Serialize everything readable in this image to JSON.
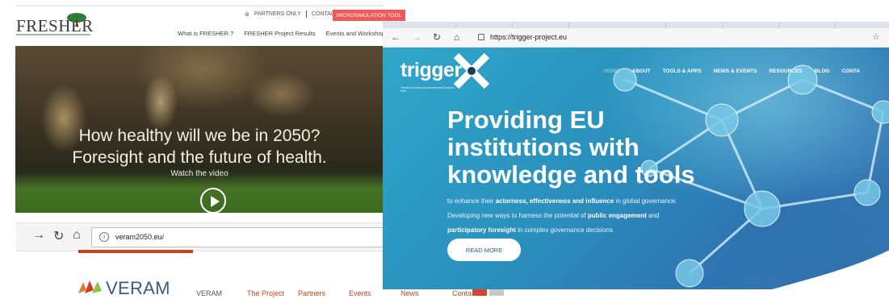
{
  "fresher": {
    "logo": "FRESHER",
    "utility": {
      "partners": "PARTNERS ONLY",
      "contact": "CONTACT"
    },
    "microsim_button": "MICROSIMULATION TOOL",
    "nav": [
      "What is FRESHER ?",
      "FRESHER Project Results",
      "Events and Workshops"
    ],
    "hero": {
      "line1": "How healthy will we be in 2050?",
      "line2": "Foresight and the future of health.",
      "watch": "Watch the video"
    }
  },
  "veram": {
    "url": "veram2050.eu/",
    "logo": "VERAM",
    "menu": [
      {
        "label": "VERAM",
        "color": "#555555"
      },
      {
        "label": "The Project",
        "color": "#c9441e"
      },
      {
        "label": "Partners",
        "color": "#c9441e"
      },
      {
        "label": "Events",
        "color": "#c9441e"
      },
      {
        "label": "News",
        "color": "#c9441e"
      },
      {
        "label": "Conta",
        "color": "#c9441e"
      }
    ]
  },
  "trigger": {
    "url": "https://trigger-project.eu",
    "brand": "trigger",
    "brand_sub": "Trends in Global Governance and Europe's Role",
    "nav": [
      "HOME",
      "ABOUT",
      "TOOLS & APPS",
      "NEWS & EVENTS",
      "RESOURCES",
      "BLOG",
      "CONTA"
    ],
    "headline": [
      "Providing EU",
      "institutions with",
      "knowledge and tools"
    ],
    "paragraph": [
      {
        "text": "to enhance their ",
        "bold": false
      },
      {
        "text": "actorness, effectiveness and influence",
        "bold": true
      },
      {
        "text": " in global governance. Developing new ways to harness the potential of ",
        "bold": false
      },
      {
        "text": "public engagement",
        "bold": true
      },
      {
        "text": " and ",
        "bold": false
      },
      {
        "text": "participatory foresight",
        "bold": true
      },
      {
        "text": " in complex governance decisions",
        "bold": false
      }
    ],
    "read_more": "READ MORE"
  },
  "colors": {
    "fresher_accent": "#f05a5a",
    "veram_accent": "#c9441e",
    "trigger_bg": "#2a8fbd"
  }
}
